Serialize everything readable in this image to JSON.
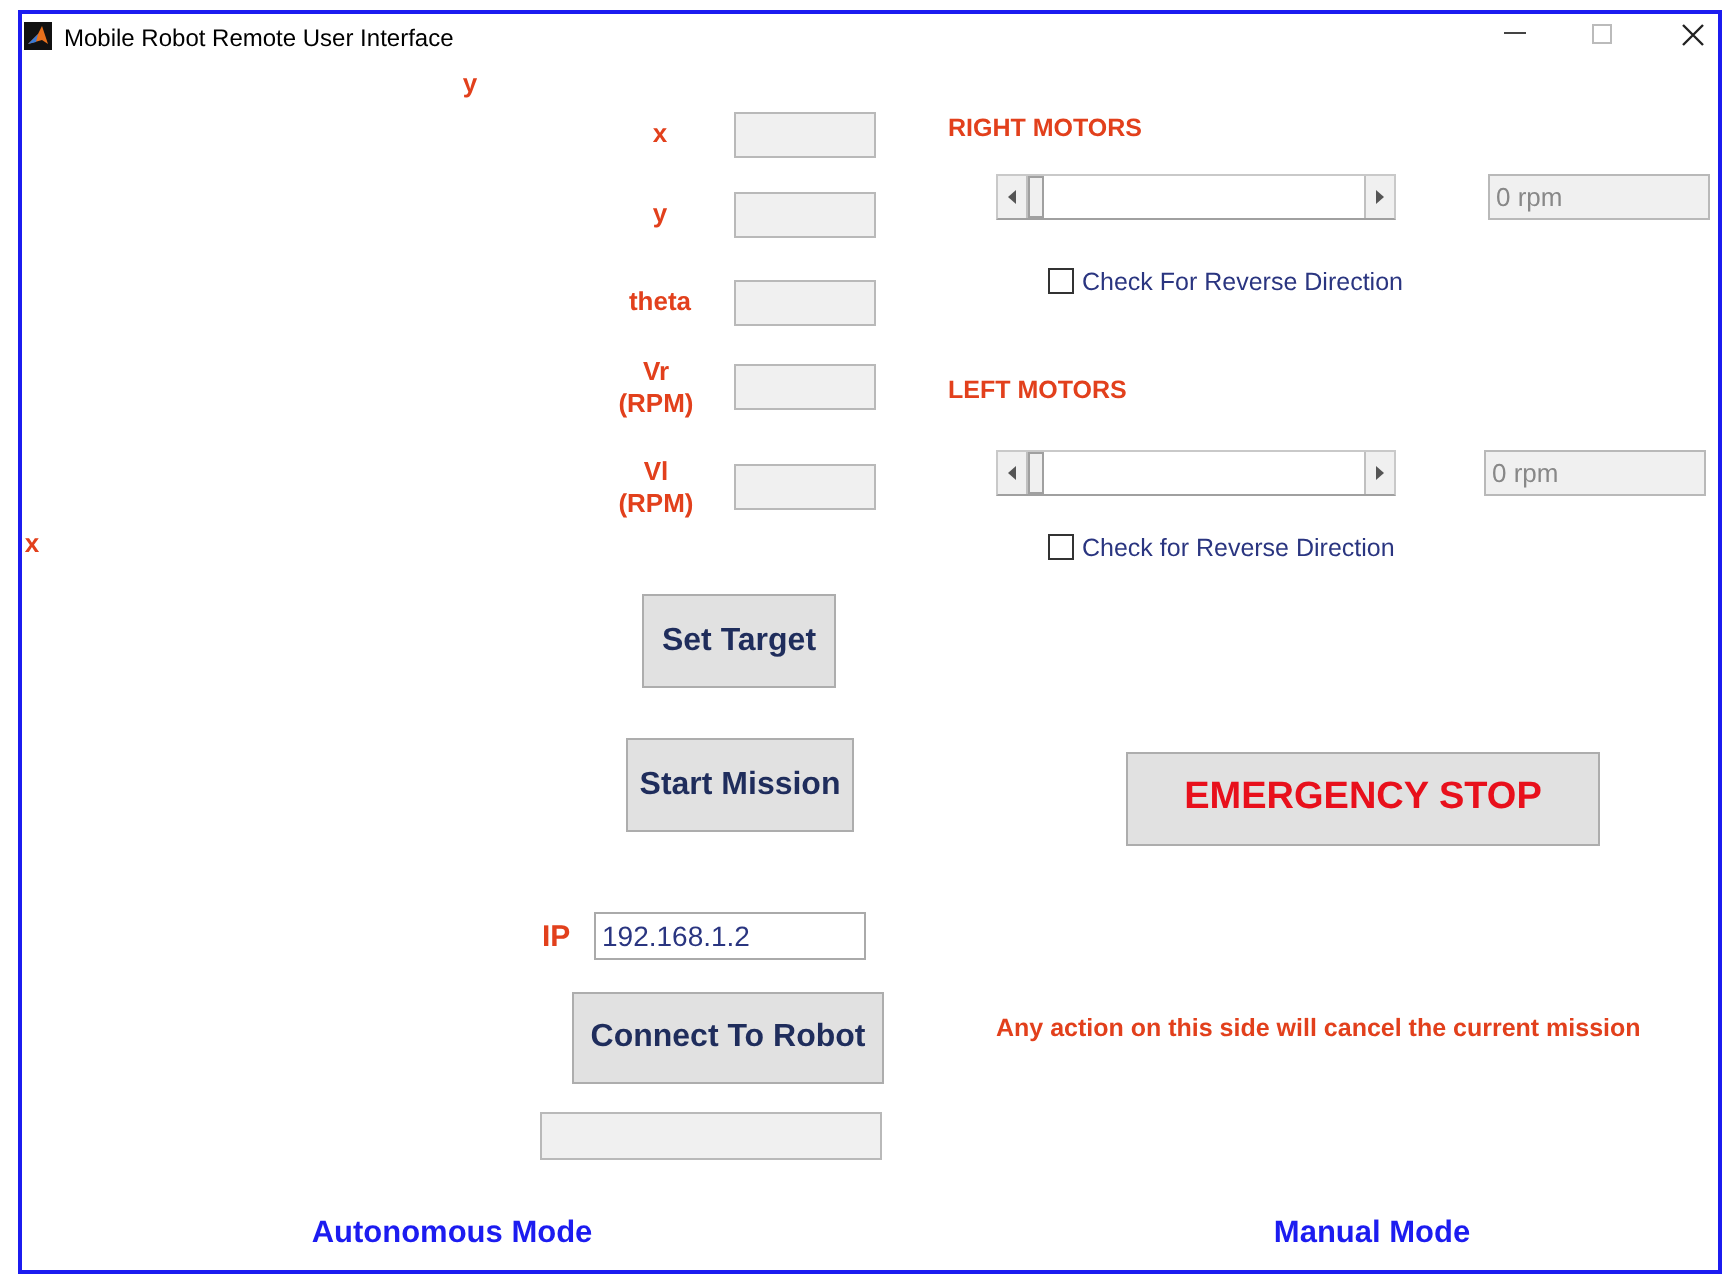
{
  "window": {
    "title": "Mobile Robot Remote User Interface"
  },
  "axes": {
    "y_label": "y",
    "x_label": "x"
  },
  "target_fields": [
    {
      "label": "x"
    },
    {
      "label": "y"
    },
    {
      "label": "theta"
    },
    {
      "label": "Vr (RPM)"
    },
    {
      "label": "Vl (RPM)"
    }
  ],
  "set_target_button": "Set Target",
  "start_mission_button": "Start Mission",
  "ip": {
    "label": "IP",
    "value": "192.168.1.2"
  },
  "connect_button": "Connect To Robot",
  "motors": [
    {
      "title": "RIGHT MOTORS",
      "level": 0,
      "reading": "0 rpm",
      "reverse_label": "Check For Reverse Direction",
      "reverse_checked": false
    },
    {
      "title": "LEFT MOTORS",
      "level": 0,
      "reading": "0 rpm",
      "reverse_label": "Check for Reverse Direction",
      "reverse_checked": false
    }
  ],
  "emergency_button": "EMERGENCY STOP",
  "warning": "Any action on this side will cancel the current mission",
  "modes": [
    {
      "label": "Autonomous Mode"
    },
    {
      "label": "Manual Mode"
    }
  ]
}
